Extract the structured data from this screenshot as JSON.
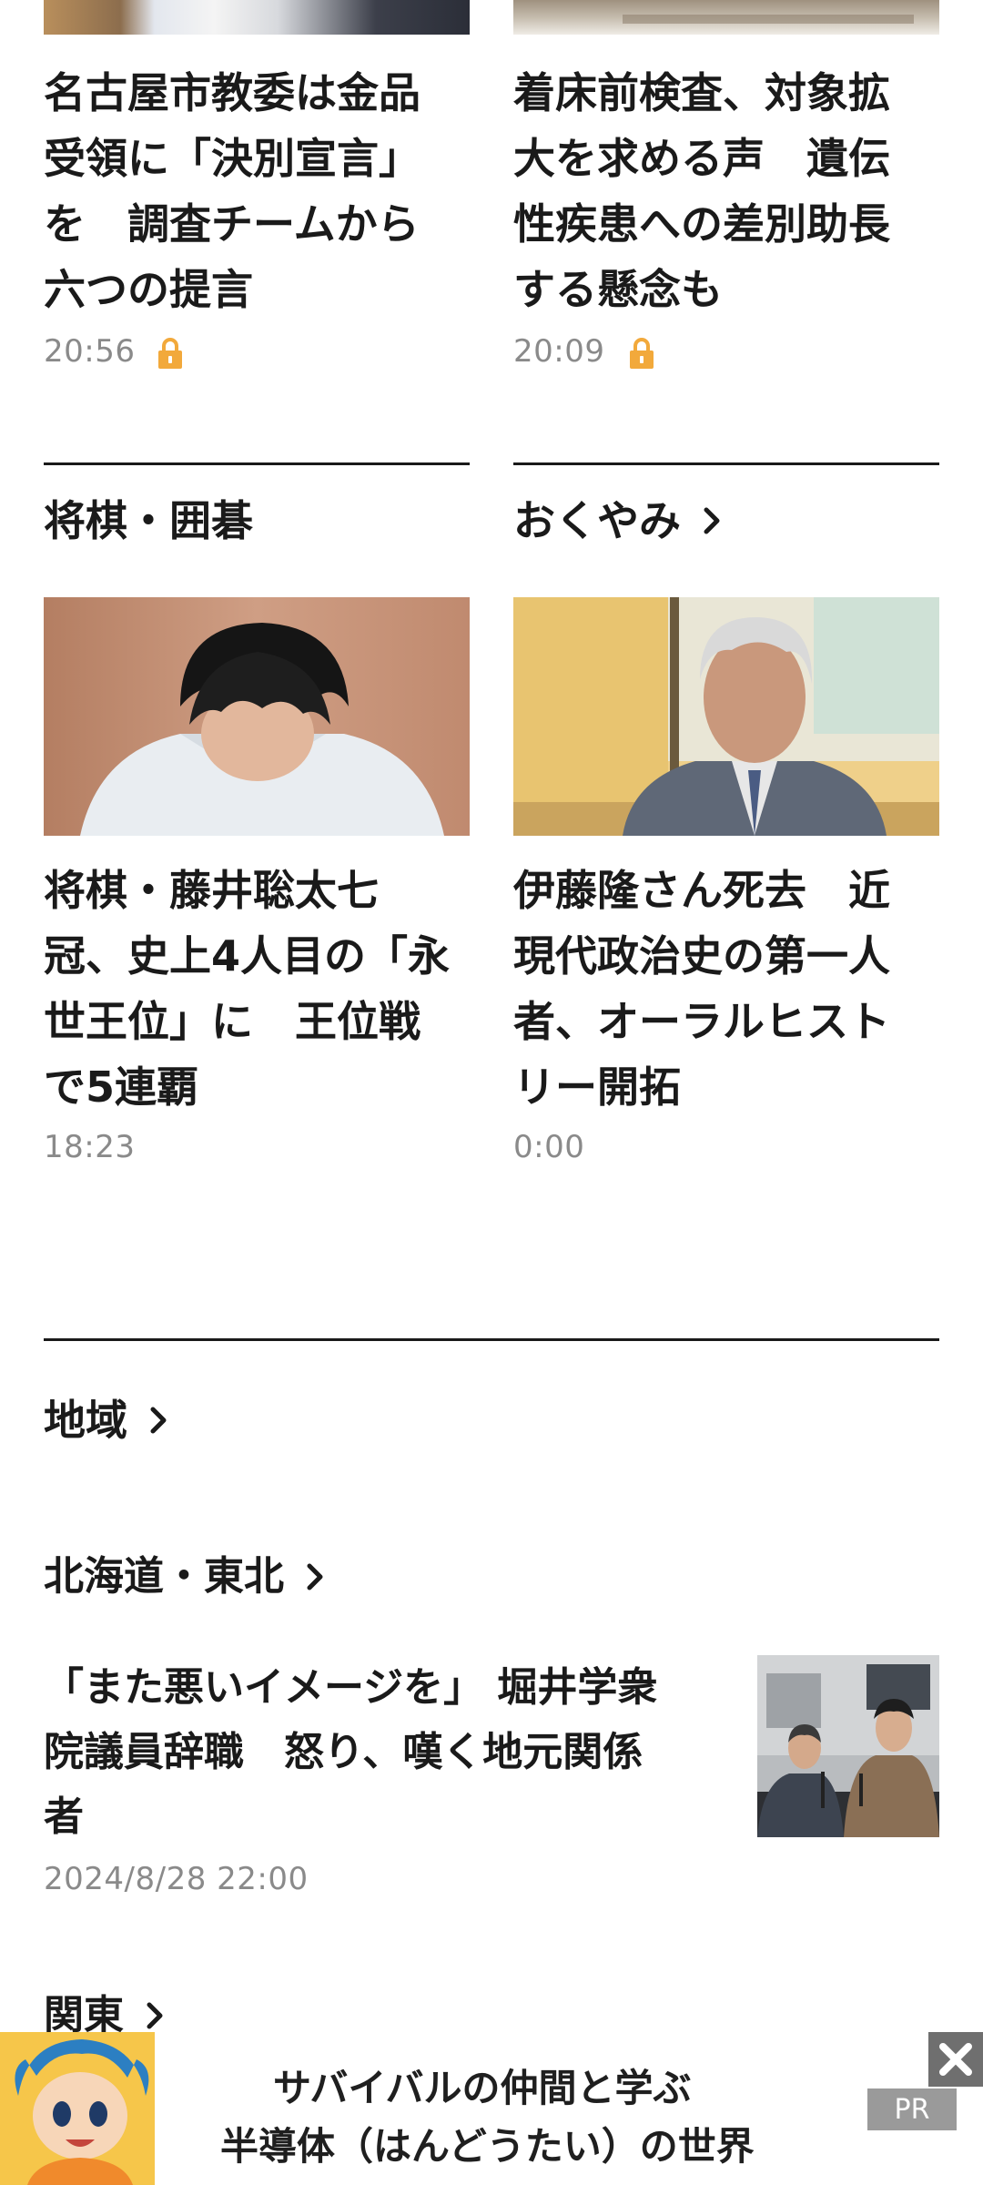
{
  "articles_top": [
    {
      "headline_lines": [
        "名古屋市教委は金品",
        "受領に「決別宣言」",
        "を　調査チームから",
        "六つの提言"
      ],
      "time": "20:56",
      "locked": true
    },
    {
      "headline_lines": [
        "着床前検査、対象拡",
        "大を求める声　遺伝",
        "性疾患への差別助長",
        "する懸念も"
      ],
      "time": "20:09",
      "locked": true
    }
  ],
  "sections_mid": [
    {
      "title": "将棋・囲碁",
      "has_chevron": false,
      "article": {
        "headline_lines": [
          "将棋・藤井聡太七",
          "冠、史上4人目の「永",
          "世王位」に　王位戦",
          "で5連覇"
        ],
        "time": "18:23"
      }
    },
    {
      "title": "おくやみ",
      "has_chevron": true,
      "article": {
        "headline_lines": [
          "伊藤隆さん死去　近",
          "現代政治史の第一人",
          "者、オーラルヒスト",
          "リー開拓"
        ],
        "time": "0:00"
      }
    }
  ],
  "region": {
    "title": "地域",
    "subsections": [
      {
        "title": "北海道・東北",
        "article": {
          "headline_lines": [
            "「また悪いイメージを」 堀井学衆",
            "院議員辞職　怒り、嘆く地元関係",
            "者"
          ],
          "time": "2024/8/28 22:00"
        }
      },
      {
        "title": "関東"
      }
    ]
  },
  "ad": {
    "line1": "サバイバルの仲間と学ぶ",
    "line2": "半導体（はんどうたい）の世界",
    "badge": "PR"
  },
  "icons": {
    "lock": "lock-icon",
    "chevron": "chevron-right-icon",
    "close": "close-icon"
  },
  "colors": {
    "lock": "#f2a93b",
    "text": "#1a1a1a",
    "muted": "#8a8a8a"
  }
}
